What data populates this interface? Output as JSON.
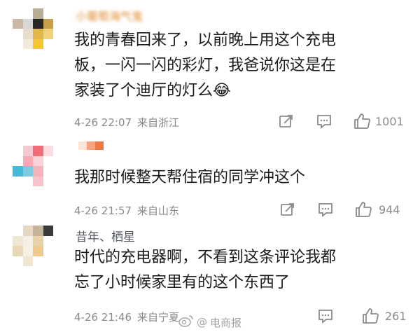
{
  "comments": [
    {
      "username": "小葡萄海气鬼",
      "text_lines": [
        "我的青春回来了，以前晚上用这个充电",
        "板，一闪一闪的彩灯，我爸说你这是在",
        "家装了个迪厅的灯么"
      ],
      "emoji": "😂",
      "time": "4-26 22:07",
      "location": "来自浙江",
      "likes": "1001",
      "avatar_colors": [
        "#ffffff",
        "#ffffff",
        "#b9ad96",
        "#ffffff",
        "#c9b8a3",
        "#d7d7d7",
        "#262626",
        "#c9a04a",
        "#ffffff",
        "#e9dcc8",
        "#e4b64a",
        "#f0d27a",
        "#ffffff",
        "#f2e9d8",
        "#f5c533",
        "#ffffff"
      ]
    },
    {
      "username": "",
      "text_lines": [
        "我那时候整天帮住宿的同学冲这个"
      ],
      "time": "4-26 21:57",
      "location": "来自山东",
      "likes": "944",
      "avatar_colors": [
        "#ffffff",
        "#f7c8d0",
        "#f06d77",
        "#fbdcdf",
        "#ffffff",
        "#f8a9b3",
        "#fcd3d8",
        "#ffffff",
        "#48b8d8",
        "#7ec8e0",
        "#f2b3b9",
        "#ffffff",
        "#ffffff",
        "#ffffff",
        "#f8c2c9",
        "#ffffff"
      ],
      "name_colors": [
        "#fde5d6",
        "#f8a27c",
        "#f07845"
      ]
    },
    {
      "username": "昔年、栖星",
      "text_lines": [
        "时代的充电器啊，不看到这条评论我都",
        "忘了小时候家里有的这个东西了"
      ],
      "time": "4-26 21:46",
      "location": "来自宁夏",
      "likes": "261",
      "avatar_colors": [
        "#ffffff",
        "#e6d8c0",
        "#c4b49a",
        "#3a3a3a",
        "#f0e6d4",
        "#f5f0e6",
        "#e8d2a8",
        "#ffffff",
        "#e8d8b8",
        "#f7f1e4",
        "#f2c98c",
        "#ffffff",
        "#ffffff",
        "#efe5d2",
        "#ffffff",
        "#ffffff"
      ]
    }
  ],
  "watermark": "电商报",
  "icons": {
    "repost": "repost-icon",
    "comment": "comment-icon",
    "like": "like-icon",
    "weibo": "weibo-logo-icon"
  }
}
